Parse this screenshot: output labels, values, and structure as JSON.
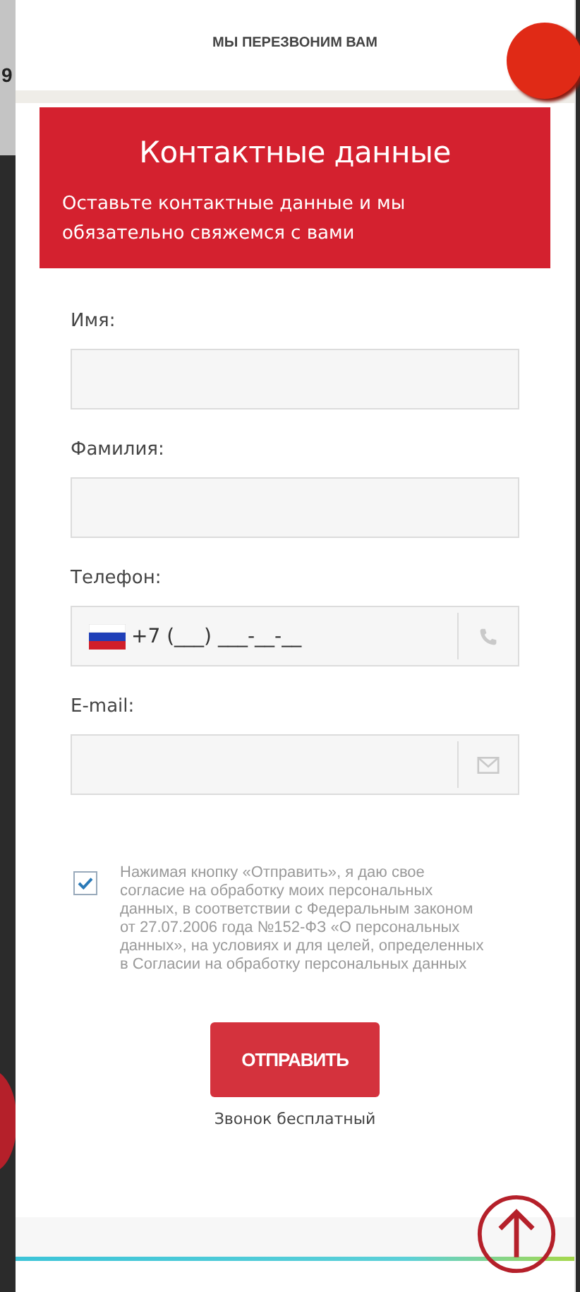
{
  "background": {
    "fragment": "9"
  },
  "header": {
    "title": "МЫ ПЕРЕЗВОНИМ ВАМ"
  },
  "banner": {
    "title": "Контактные данные",
    "subtitle": "Оставьте контактные данные и мы обязательно свяжемся с вами"
  },
  "fields": [
    {
      "label": "Имя:",
      "kind": "text"
    },
    {
      "label": "Фамилия:",
      "kind": "text"
    },
    {
      "label": "Телефон:",
      "kind": "phone",
      "value": "+7 (___) ___-__-__"
    },
    {
      "label": "E-mail:",
      "kind": "email"
    }
  ],
  "consent": {
    "checked": true,
    "text": "Нажимая кнопку «Отправить», я даю свое согласие на обработку моих персональных данных, в соответствии с Федеральным законом от 27.07.2006 года №152-ФЗ «О персональных данных», на условиях и для целей, определенных в Согласии на обработку персональных данных"
  },
  "submit": {
    "label": "ОТПРАВИТЬ",
    "note": "Звонок бесплатный"
  }
}
